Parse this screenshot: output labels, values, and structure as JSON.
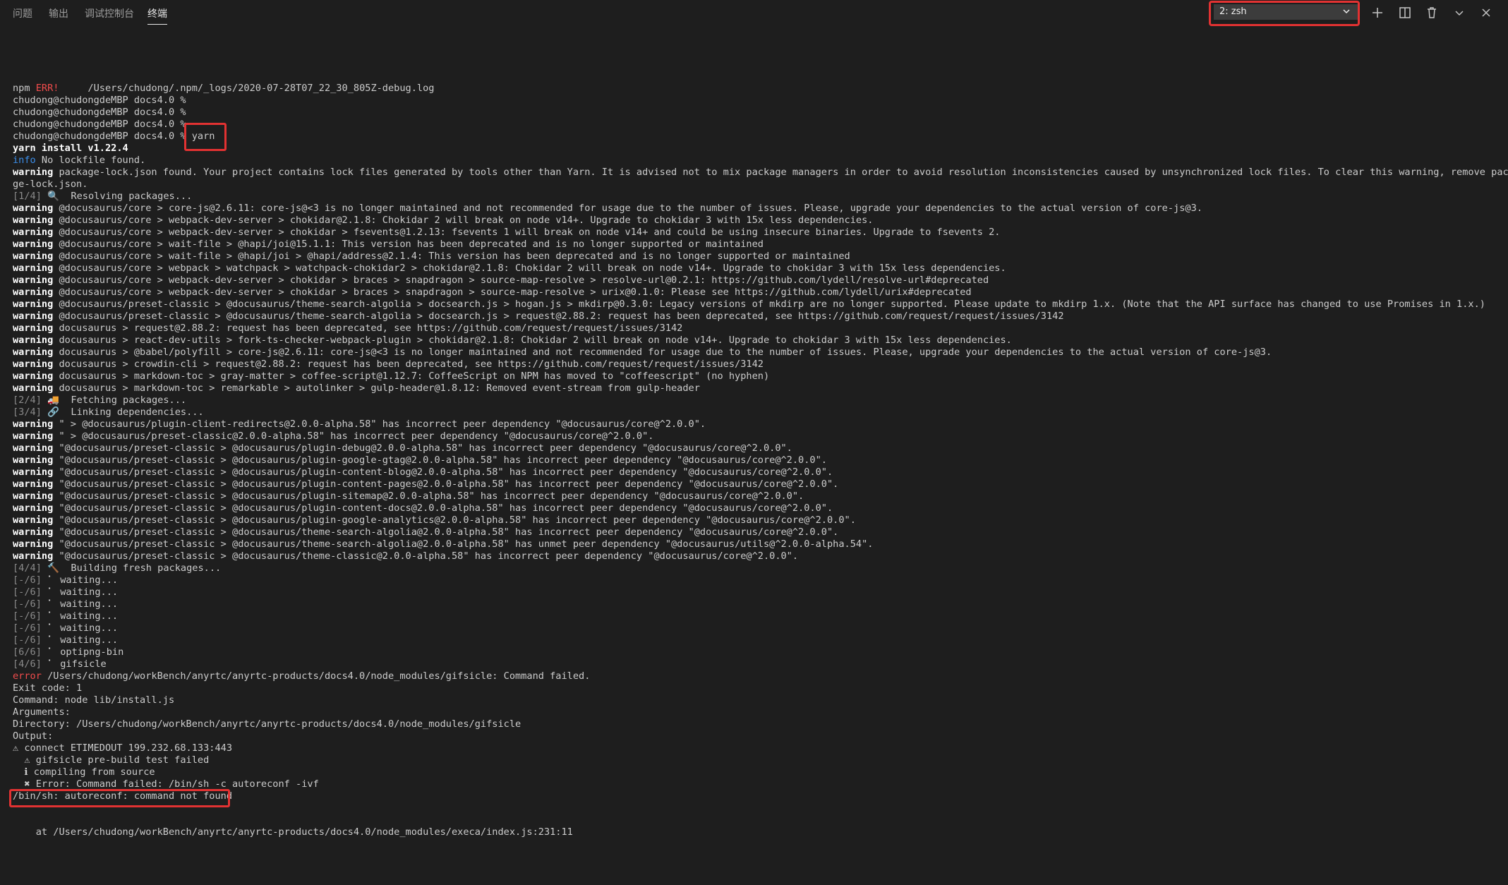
{
  "panel": {
    "tabs": [
      {
        "label": "问题"
      },
      {
        "label": "输出"
      },
      {
        "label": "调试控制台"
      },
      {
        "label": "终端"
      }
    ],
    "terminal_select": "2: zsh",
    "icons": [
      "plus-icon",
      "split-icon",
      "trash-icon",
      "chevron-down-icon",
      "close-icon"
    ]
  },
  "terminal": {
    "lines": [
      [
        {
          "t": "npm "
        },
        {
          "t": "ERR!",
          "c": "r"
        },
        {
          "t": "     /Users/chudong/.npm/_logs/2020-07-28T07_22_30_805Z-debug.log"
        }
      ],
      [
        {
          "t": "chudong@chudongdeMBP docs4.0 %"
        }
      ],
      [
        {
          "t": "chudong@chudongdeMBP docs4.0 %"
        }
      ],
      [
        {
          "t": "chudong@chudongdeMBP docs4.0 %"
        }
      ],
      [
        {
          "t": "chudong@chudongdeMBP docs4.0 % yarn"
        }
      ],
      [
        {
          "t": "yarn install v1.22.4",
          "c": "w"
        }
      ],
      [
        {
          "t": "info",
          "c": "b"
        },
        {
          "t": " No lockfile found."
        }
      ],
      [
        {
          "t": "warning",
          "c": "w"
        },
        {
          "t": " package-lock.json found. Your project contains lock files generated by tools other than Yarn. It is advised not to mix package managers in order to avoid resolution inconsistencies caused by unsynchronized lock files. To clear this warning, remove packa"
        }
      ],
      [
        {
          "t": "ge-lock.json."
        }
      ],
      [
        {
          "t": "[1/4]",
          "c": "g"
        },
        {
          "t": " 🔍  Resolving packages..."
        }
      ],
      [
        {
          "t": "warning",
          "c": "w"
        },
        {
          "t": " @docusaurus/core > core-js@2.6.11: core-js@<3 is no longer maintained and not recommended for usage due to the number of issues. Please, upgrade your dependencies to the actual version of core-js@3."
        }
      ],
      [
        {
          "t": "warning",
          "c": "w"
        },
        {
          "t": " @docusaurus/core > webpack-dev-server > chokidar@2.1.8: Chokidar 2 will break on node v14+. Upgrade to chokidar 3 with 15x less dependencies."
        }
      ],
      [
        {
          "t": "warning",
          "c": "w"
        },
        {
          "t": " @docusaurus/core > webpack-dev-server > chokidar > fsevents@1.2.13: fsevents 1 will break on node v14+ and could be using insecure binaries. Upgrade to fsevents 2."
        }
      ],
      [
        {
          "t": "warning",
          "c": "w"
        },
        {
          "t": " @docusaurus/core > wait-file > @hapi/joi@15.1.1: This version has been deprecated and is no longer supported or maintained"
        }
      ],
      [
        {
          "t": "warning",
          "c": "w"
        },
        {
          "t": " @docusaurus/core > wait-file > @hapi/joi > @hapi/address@2.1.4: This version has been deprecated and is no longer supported or maintained"
        }
      ],
      [
        {
          "t": "warning",
          "c": "w"
        },
        {
          "t": " @docusaurus/core > webpack > watchpack > watchpack-chokidar2 > chokidar@2.1.8: Chokidar 2 will break on node v14+. Upgrade to chokidar 3 with 15x less dependencies."
        }
      ],
      [
        {
          "t": "warning",
          "c": "w"
        },
        {
          "t": " @docusaurus/core > webpack-dev-server > chokidar > braces > snapdragon > source-map-resolve > resolve-url@0.2.1: https://github.com/lydell/resolve-url#deprecated"
        }
      ],
      [
        {
          "t": "warning",
          "c": "w"
        },
        {
          "t": " @docusaurus/core > webpack-dev-server > chokidar > braces > snapdragon > source-map-resolve > urix@0.1.0: Please see https://github.com/lydell/urix#deprecated"
        }
      ],
      [
        {
          "t": "warning",
          "c": "w"
        },
        {
          "t": " @docusaurus/preset-classic > @docusaurus/theme-search-algolia > docsearch.js > hogan.js > mkdirp@0.3.0: Legacy versions of mkdirp are no longer supported. Please update to mkdirp 1.x. (Note that the API surface has changed to use Promises in 1.x.)"
        }
      ],
      [
        {
          "t": "warning",
          "c": "w"
        },
        {
          "t": " @docusaurus/preset-classic > @docusaurus/theme-search-algolia > docsearch.js > request@2.88.2: request has been deprecated, see https://github.com/request/request/issues/3142"
        }
      ],
      [
        {
          "t": "warning",
          "c": "w"
        },
        {
          "t": " docusaurus > request@2.88.2: request has been deprecated, see https://github.com/request/request/issues/3142"
        }
      ],
      [
        {
          "t": "warning",
          "c": "w"
        },
        {
          "t": " docusaurus > react-dev-utils > fork-ts-checker-webpack-plugin > chokidar@2.1.8: Chokidar 2 will break on node v14+. Upgrade to chokidar 3 with 15x less dependencies."
        }
      ],
      [
        {
          "t": "warning",
          "c": "w"
        },
        {
          "t": " docusaurus > @babel/polyfill > core-js@2.6.11: core-js@<3 is no longer maintained and not recommended for usage due to the number of issues. Please, upgrade your dependencies to the actual version of core-js@3."
        }
      ],
      [
        {
          "t": "warning",
          "c": "w"
        },
        {
          "t": " docusaurus > crowdin-cli > request@2.88.2: request has been deprecated, see https://github.com/request/request/issues/3142"
        }
      ],
      [
        {
          "t": "warning",
          "c": "w"
        },
        {
          "t": " docusaurus > markdown-toc > gray-matter > coffee-script@1.12.7: CoffeeScript on NPM has moved to \"coffeescript\" (no hyphen)"
        }
      ],
      [
        {
          "t": "warning",
          "c": "w"
        },
        {
          "t": " docusaurus > markdown-toc > remarkable > autolinker > gulp-header@1.8.12: Removed event-stream from gulp-header"
        }
      ],
      [
        {
          "t": "[2/4]",
          "c": "g"
        },
        {
          "t": " 🚚  Fetching packages..."
        }
      ],
      [
        {
          "t": "[3/4]",
          "c": "g"
        },
        {
          "t": " 🔗  Linking dependencies..."
        }
      ],
      [
        {
          "t": "warning",
          "c": "w"
        },
        {
          "t": " \" > @docusaurus/plugin-client-redirects@2.0.0-alpha.58\" has incorrect peer dependency \"@docusaurus/core@^2.0.0\"."
        }
      ],
      [
        {
          "t": "warning",
          "c": "w"
        },
        {
          "t": " \" > @docusaurus/preset-classic@2.0.0-alpha.58\" has incorrect peer dependency \"@docusaurus/core@^2.0.0\"."
        }
      ],
      [
        {
          "t": "warning",
          "c": "w"
        },
        {
          "t": " \"@docusaurus/preset-classic > @docusaurus/plugin-debug@2.0.0-alpha.58\" has incorrect peer dependency \"@docusaurus/core@^2.0.0\"."
        }
      ],
      [
        {
          "t": "warning",
          "c": "w"
        },
        {
          "t": " \"@docusaurus/preset-classic > @docusaurus/plugin-google-gtag@2.0.0-alpha.58\" has incorrect peer dependency \"@docusaurus/core@^2.0.0\"."
        }
      ],
      [
        {
          "t": "warning",
          "c": "w"
        },
        {
          "t": " \"@docusaurus/preset-classic > @docusaurus/plugin-content-blog@2.0.0-alpha.58\" has incorrect peer dependency \"@docusaurus/core@^2.0.0\"."
        }
      ],
      [
        {
          "t": "warning",
          "c": "w"
        },
        {
          "t": " \"@docusaurus/preset-classic > @docusaurus/plugin-content-pages@2.0.0-alpha.58\" has incorrect peer dependency \"@docusaurus/core@^2.0.0\"."
        }
      ],
      [
        {
          "t": "warning",
          "c": "w"
        },
        {
          "t": " \"@docusaurus/preset-classic > @docusaurus/plugin-sitemap@2.0.0-alpha.58\" has incorrect peer dependency \"@docusaurus/core@^2.0.0\"."
        }
      ],
      [
        {
          "t": "warning",
          "c": "w"
        },
        {
          "t": " \"@docusaurus/preset-classic > @docusaurus/plugin-content-docs@2.0.0-alpha.58\" has incorrect peer dependency \"@docusaurus/core@^2.0.0\"."
        }
      ],
      [
        {
          "t": "warning",
          "c": "w"
        },
        {
          "t": " \"@docusaurus/preset-classic > @docusaurus/plugin-google-analytics@2.0.0-alpha.58\" has incorrect peer dependency \"@docusaurus/core@^2.0.0\"."
        }
      ],
      [
        {
          "t": "warning",
          "c": "w"
        },
        {
          "t": " \"@docusaurus/preset-classic > @docusaurus/theme-search-algolia@2.0.0-alpha.58\" has incorrect peer dependency \"@docusaurus/core@^2.0.0\"."
        }
      ],
      [
        {
          "t": "warning",
          "c": "w"
        },
        {
          "t": " \"@docusaurus/preset-classic > @docusaurus/theme-search-algolia@2.0.0-alpha.58\" has unmet peer dependency \"@docusaurus/utils@^2.0.0-alpha.54\"."
        }
      ],
      [
        {
          "t": "warning",
          "c": "w"
        },
        {
          "t": " \"@docusaurus/preset-classic > @docusaurus/theme-classic@2.0.0-alpha.58\" has incorrect peer dependency \"@docusaurus/core@^2.0.0\"."
        }
      ],
      [
        {
          "t": "[4/4]",
          "c": "g"
        },
        {
          "t": " 🔨  Building fresh packages..."
        }
      ],
      [
        {
          "t": "[-/6]",
          "c": "g"
        },
        {
          "t": " ⠁ waiting..."
        }
      ],
      [
        {
          "t": "[-/6]",
          "c": "g"
        },
        {
          "t": " ⠁ waiting..."
        }
      ],
      [
        {
          "t": "[-/6]",
          "c": "g"
        },
        {
          "t": " ⠁ waiting..."
        }
      ],
      [
        {
          "t": "[-/6]",
          "c": "g"
        },
        {
          "t": " ⠁ waiting..."
        }
      ],
      [
        {
          "t": "[-/6]",
          "c": "g"
        },
        {
          "t": " ⠁ waiting..."
        }
      ],
      [
        {
          "t": "[-/6]",
          "c": "g"
        },
        {
          "t": " ⠁ waiting..."
        }
      ],
      [
        {
          "t": "[6/6]",
          "c": "g"
        },
        {
          "t": " ⠁ optipng-bin"
        }
      ],
      [
        {
          "t": "[4/6]",
          "c": "g"
        },
        {
          "t": " ⠁ gifsicle"
        }
      ],
      [
        {
          "t": "error",
          "c": "r"
        },
        {
          "t": " /Users/chudong/workBench/anyrtc/anyrtc-products/docs4.0/node_modules/gifsicle: Command failed."
        }
      ],
      [
        {
          "t": "Exit code: 1"
        }
      ],
      [
        {
          "t": "Command: node lib/install.js"
        }
      ],
      [
        {
          "t": "Arguments:"
        }
      ],
      [
        {
          "t": "Directory: /Users/chudong/workBench/anyrtc/anyrtc-products/docs4.0/node_modules/gifsicle"
        }
      ],
      [
        {
          "t": "Output:"
        }
      ],
      [
        {
          "t": "⚠ connect ETIMEDOUT 199.232.68.133:443"
        }
      ],
      [
        {
          "t": "  ⚠ gifsicle pre-build test failed"
        }
      ],
      [
        {
          "t": "  ℹ compiling from source"
        }
      ],
      [
        {
          "t": "  ✖ Error: Command failed: /bin/sh -c autoreconf -ivf"
        }
      ],
      [
        {
          "t": "/bin/sh: autoreconf: command not found"
        }
      ],
      [
        {
          "t": ""
        }
      ],
      [
        {
          "t": ""
        }
      ],
      [
        {
          "t": "    at /Users/chudong/workBench/anyrtc/anyrtc-products/docs4.0/node_modules/execa/index.js:231:11"
        }
      ]
    ]
  }
}
